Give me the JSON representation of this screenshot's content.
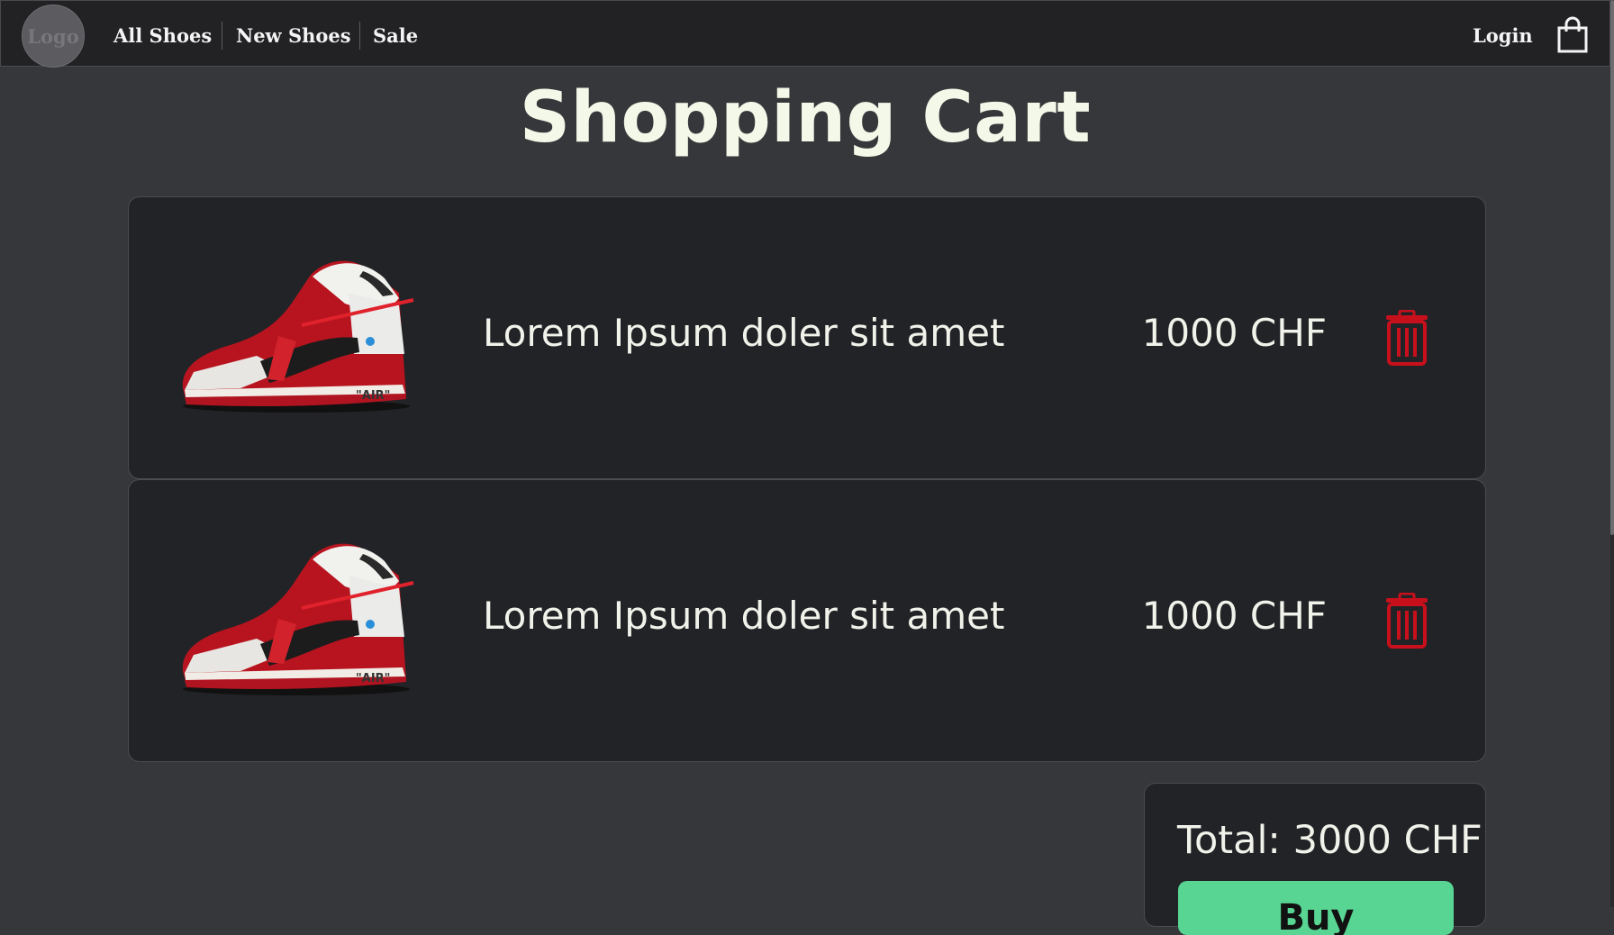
{
  "nav": {
    "logo_text": "Logo",
    "links": [
      "All Shoes",
      "New Shoes",
      "Sale"
    ],
    "login_label": "Login",
    "cart_icon": "shopping-bag-icon"
  },
  "page": {
    "title": "Shopping Cart"
  },
  "cart": {
    "items": [
      {
        "name": "Lorem Ipsum doler sit amet",
        "price": "1000 CHF",
        "image": "sneaker-red-white-image",
        "delete_icon": "trash-icon"
      },
      {
        "name": "Lorem Ipsum doler sit amet",
        "price": "1000 CHF",
        "image": "sneaker-red-white-image",
        "delete_icon": "trash-icon"
      }
    ],
    "total_label": "Total: 3000 CHF",
    "buy_label": "Buy"
  },
  "colors": {
    "background": "#36373a",
    "navbar": "#222225",
    "card": "#222327",
    "title": "#f3f8e8",
    "delete": "#c8101c",
    "buy_button": "#58d592"
  }
}
